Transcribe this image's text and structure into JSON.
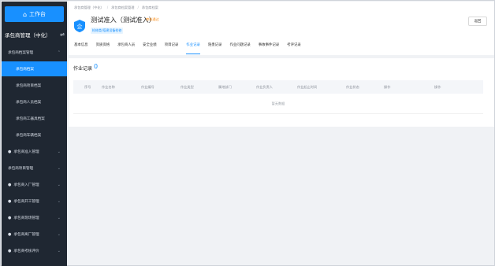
{
  "sidebar": {
    "top_button": "工作台",
    "section_title": "承包商管理（中化）",
    "items": [
      {
        "label": "承包商档案管理"
      },
      {
        "label": "承包商档案"
      },
      {
        "label": "承包商项目档案"
      },
      {
        "label": "承包商人员档案"
      },
      {
        "label": "承包商工器具档案"
      },
      {
        "label": "承包商车辆档案"
      },
      {
        "label": "承包商准入管理"
      },
      {
        "label": "承包商项目管理"
      },
      {
        "label": "承包商入厂管理"
      },
      {
        "label": "承包商开工管理"
      },
      {
        "label": "承包商现场管理"
      },
      {
        "label": "承包商离厂管理"
      },
      {
        "label": "承包商考核评价"
      }
    ]
  },
  "header": {
    "breadcrumb": [
      "承包商管理（中化）",
      "承包商档案管理",
      "承包商档案"
    ],
    "enterprise_name": "测试准入（测试准入）",
    "status": "审核通过",
    "tag": "检修类/搭建设备检修",
    "back_button": "返回",
    "tabs": [
      "基本信息",
      "资质资格",
      "承包商人员",
      "安全业绩",
      "项目记录",
      "作业记录",
      "隐患记录",
      "作业问题记录",
      "事故事件记录",
      "考评记录"
    ],
    "active_tab": "作业记录"
  },
  "records": {
    "title": "作业记录",
    "count": "0",
    "columns": [
      "序号",
      "作业名称",
      "作业编号",
      "作业类型",
      "属地部门",
      "作业负责人",
      "作业起止时间",
      "作业状态",
      "操作",
      "操作"
    ],
    "empty_text": "暂无数据"
  },
  "colors": {
    "accent": "#1890ff",
    "sidebar_bg": "#1f2732",
    "status": "#fa8c16"
  }
}
